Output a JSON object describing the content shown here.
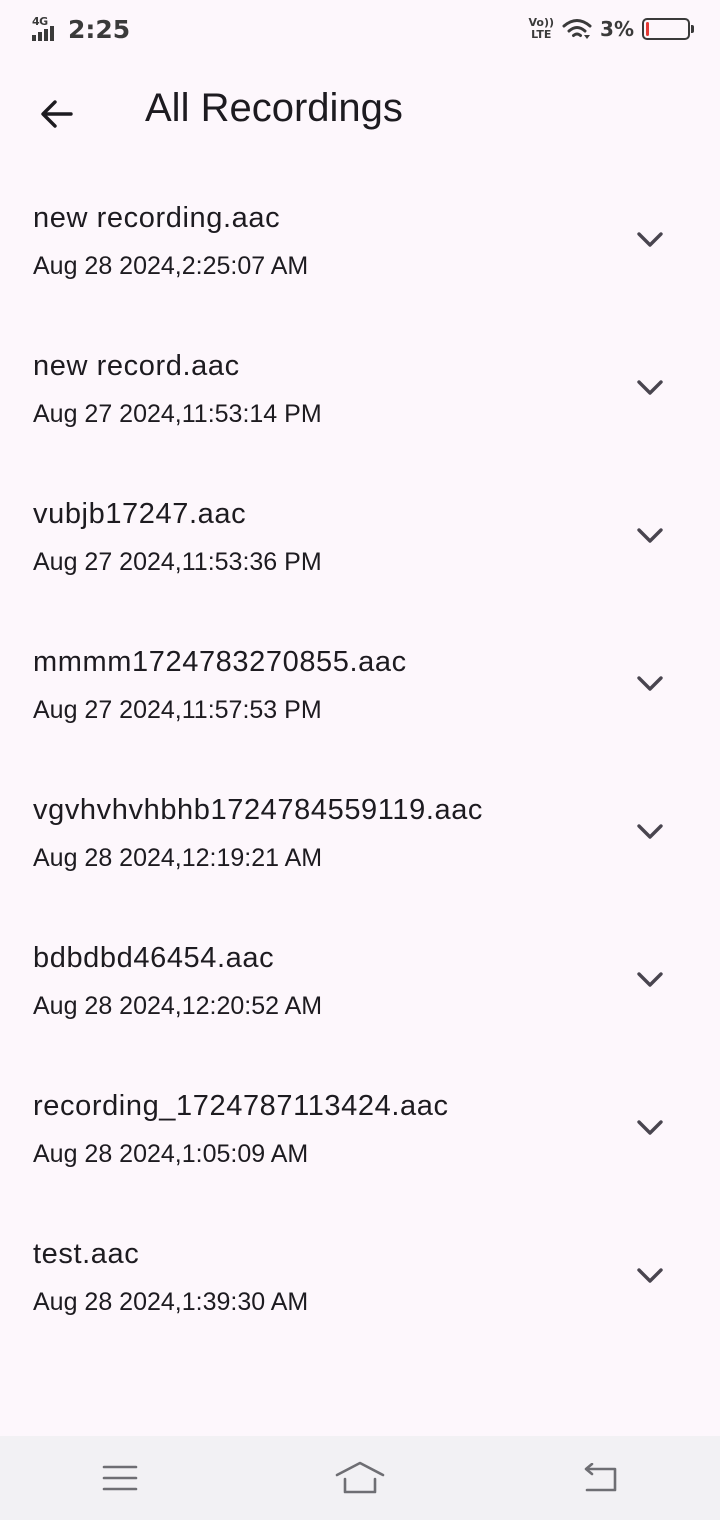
{
  "status_bar": {
    "network": "4G",
    "time": "2:25",
    "volte_top": "Vo))",
    "volte_bottom": "LTE",
    "battery": "3%",
    "battery_level": 0.03,
    "battery_color": "#e53935"
  },
  "app_bar": {
    "title": "All Recordings",
    "back_icon": "arrow-back-icon"
  },
  "recordings": [
    {
      "name": "new recording.aac",
      "date": "Aug 28 2024,2:25:07 AM"
    },
    {
      "name": "new record.aac",
      "date": "Aug 27 2024,11:53:14 PM"
    },
    {
      "name": "vubjb17247.aac",
      "date": "Aug 27 2024,11:53:36 PM"
    },
    {
      "name": "mmmm1724783270855.aac",
      "date": "Aug 27 2024,11:57:53 PM"
    },
    {
      "name": "vgvhvhvhbhb1724784559119.aac",
      "date": "Aug 28 2024,12:19:21 AM"
    },
    {
      "name": "bdbdbd46454.aac",
      "date": "Aug 28 2024,12:20:52 AM"
    },
    {
      "name": "recording_1724787113424.aac",
      "date": "Aug 28 2024,1:05:09 AM"
    },
    {
      "name": "test.aac",
      "date": "Aug 28 2024,1:39:30 AM"
    }
  ],
  "nav_bar": {
    "icons": [
      "menu-icon",
      "home-icon",
      "back-icon"
    ]
  }
}
